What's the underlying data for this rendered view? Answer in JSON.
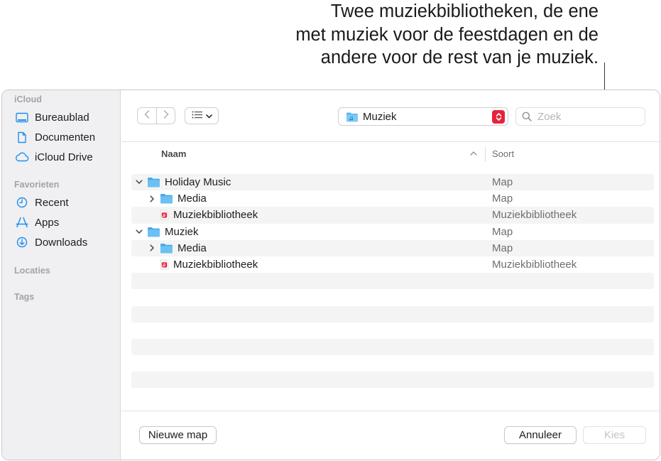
{
  "callout": {
    "line1": "Twee muziekbibliotheken, de ene",
    "line2": "met muziek voor de feestdagen en de",
    "line3": "andere voor de rest van je muziek."
  },
  "sidebar": {
    "sections": [
      {
        "title": "iCloud",
        "items": [
          {
            "label": "Bureaublad",
            "icon": "desktop-icon"
          },
          {
            "label": "Documenten",
            "icon": "document-icon"
          },
          {
            "label": "iCloud Drive",
            "icon": "cloud-icon"
          }
        ]
      },
      {
        "title": "Favorieten",
        "items": [
          {
            "label": "Recent",
            "icon": "clock-icon"
          },
          {
            "label": "Apps",
            "icon": "apps-icon"
          },
          {
            "label": "Downloads",
            "icon": "download-icon"
          }
        ]
      },
      {
        "title": "Locaties",
        "items": []
      },
      {
        "title": "Tags",
        "items": []
      }
    ]
  },
  "toolbar": {
    "location": "Muziek",
    "search_placeholder": "Zoek"
  },
  "columns": {
    "name": "Naam",
    "kind": "Soort",
    "sort_indicator": "^"
  },
  "files": [
    {
      "name": "Holiday Music",
      "kind": "Map",
      "type": "folder",
      "level": 0,
      "disclosure": "expanded"
    },
    {
      "name": "Media",
      "kind": "Map",
      "type": "folder",
      "level": 1,
      "disclosure": "collapsed"
    },
    {
      "name": "Muziekbibliotheek",
      "kind": "Muziekbibliotheek",
      "type": "library",
      "level": 1,
      "disclosure": "none"
    },
    {
      "name": "Muziek",
      "kind": "Map",
      "type": "folder",
      "level": 0,
      "disclosure": "expanded"
    },
    {
      "name": "Media",
      "kind": "Map",
      "type": "folder",
      "level": 1,
      "disclosure": "collapsed"
    },
    {
      "name": "Muziekbibliotheek",
      "kind": "Muziekbibliotheek",
      "type": "library",
      "level": 1,
      "disclosure": "none"
    }
  ],
  "buttons": {
    "new_folder": "Nieuwe map",
    "cancel": "Annuleer",
    "choose": "Kies"
  },
  "colors": {
    "accent": "#1f8ef1",
    "folder": "#5db8f0",
    "library_icon": "#e5243b",
    "sidebar_bg": "#f0f0f2"
  }
}
